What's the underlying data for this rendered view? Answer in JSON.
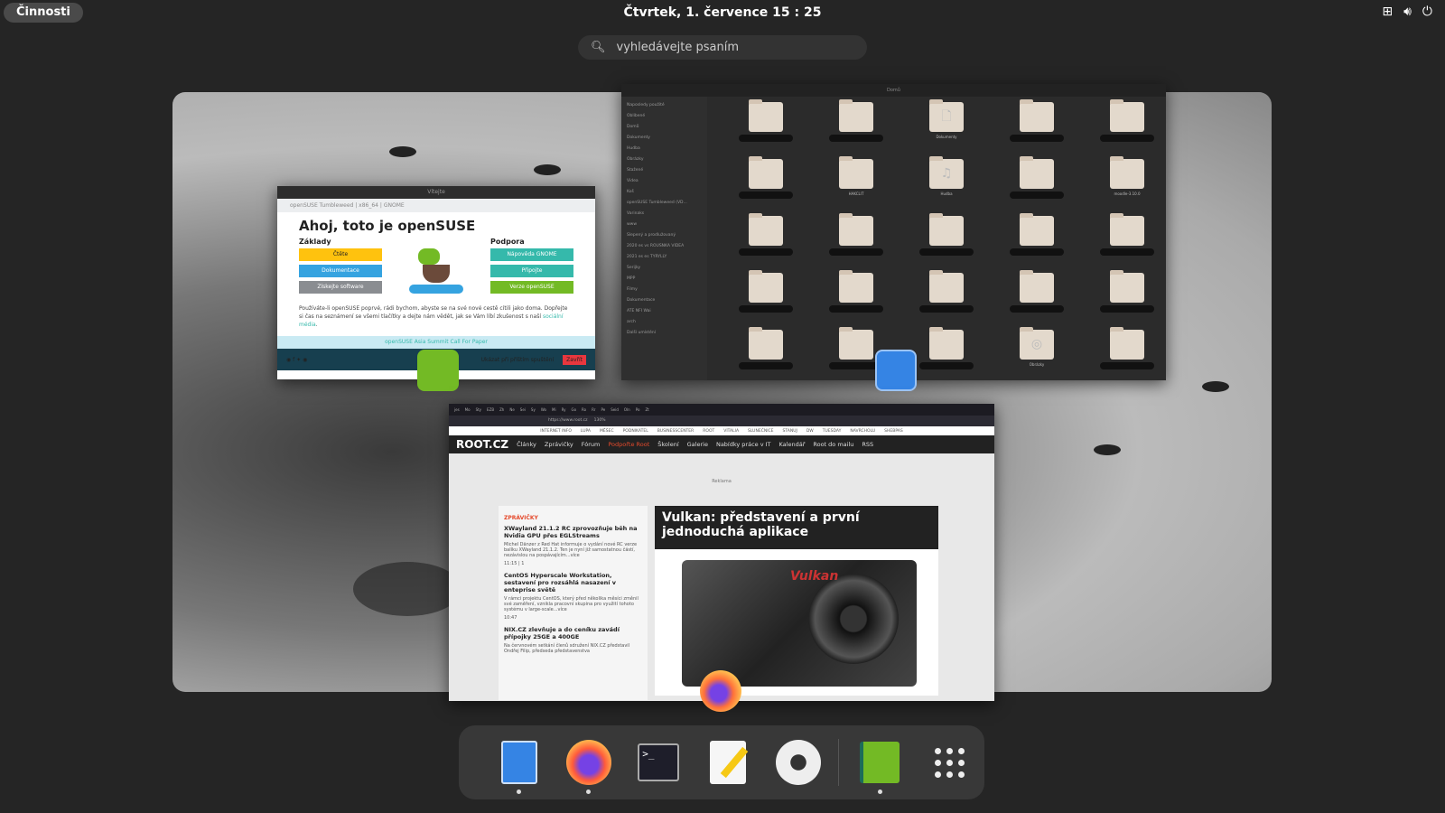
{
  "topbar": {
    "activities": "Činnosti",
    "clock": "Čtvrtek, 1. července  15 : 25",
    "tray_icons": [
      "network-icon",
      "volume-icon",
      "power-icon"
    ]
  },
  "search": {
    "placeholder": "vyhledávejte psaním"
  },
  "windows": {
    "welcome": {
      "title": "Vítejte",
      "crumb": "openSUSE Tumbleweed  |  x86_64  |  GNOME",
      "heading": "Ahoj, toto je openSUSE",
      "basics_title": "Základy",
      "basics": [
        {
          "label": "Čtěte",
          "color": "#ffc20e"
        },
        {
          "label": "Dokumentace",
          "color": "#35a3e0"
        },
        {
          "label": "Získejte software",
          "color": "#8a8d91"
        }
      ],
      "support_title": "Podpora",
      "support": [
        {
          "label": "Nápověda GNOME",
          "color": "#35b9ab"
        },
        {
          "label": "Připojte",
          "color": "#35b9ab"
        },
        {
          "label": "Verze openSUSE",
          "color": "#73ba25"
        }
      ],
      "text": "Používáte-li openSUSE poprvé, rádi bychom, abyste se na své nové cestě cítili jako doma. Dopřejte si čas na seznámení se všemi tlačítky a dejte nám vědět, jak se Vám líbí zkušenost s naší",
      "link": "sociální média",
      "banner": "openSUSE Asia Summit Call For Paper",
      "show_next": "Ukázat při příštím spuštění",
      "close": "Zavřít"
    },
    "files": {
      "title": "Domů",
      "sidebar": [
        "Naposledy použité",
        "Oblíbené",
        "Domů",
        "Dokumenty",
        "Hudba",
        "Obrázky",
        "Stažené",
        "Videa",
        "Koš",
        "openSUSE Tumbleweed (VD...",
        "Varinaks",
        "www",
        "Slepený a prodlužovaný",
        "2020 es vs ROUSNKA VIDEA",
        "2021 es es TYRYLLY",
        "Serijky",
        "MPP",
        "Filmy",
        "Dokumentace",
        "ATE NFI Wai",
        "arch",
        "Další umístění"
      ],
      "items": [
        "",
        "",
        "Dokumenty",
        "",
        "",
        "",
        "HAKCLIT",
        "Hudba",
        "",
        "moodle-3.10.0",
        "",
        "",
        "",
        "",
        "",
        "",
        "",
        "",
        "",
        "",
        "",
        "",
        "",
        "Obrázky",
        ""
      ]
    },
    "browser": {
      "tabs": [
        "jes",
        "Mo",
        "Sty",
        "EZB",
        "Zh",
        "Ne",
        "Sei",
        "Sy",
        "Wo",
        "Mi",
        "Ry",
        "Go",
        "Ro",
        "Rr",
        "Pe",
        "Seid",
        "Oln",
        "Po",
        "Zt"
      ],
      "url": "https://www.root.cz",
      "zoom": "130%",
      "network": [
        "INTERNET INFO",
        "LUPA",
        "MĚŠEC",
        "PODNIKATEL",
        "BUSINESSCENTER",
        "ROOT",
        "VITALIA",
        "SLUNEČNICE",
        "STANUJ",
        "DW",
        "TUESDAY",
        "NAVRCHOLU",
        "SHEBPAS"
      ],
      "logo": "ROOT.CZ",
      "nav": [
        "Články",
        "Zprávičky",
        "Fórum",
        "Podpořte Root",
        "Školení",
        "Galerie",
        "Nabídky práce v IT",
        "Kalendář",
        "Root do mailu",
        "RSS"
      ],
      "ad": "Reklama",
      "news_tag": "ZPRÁVIČKY",
      "news": [
        {
          "title": "XWayland 21.1.2 RC zprovozňuje běh na Nvidia GPU přes EGLStreams",
          "text": "Michel Dänzer z Red Hat informuje o vydání nové RC verze balíku XWayland 21.1.2. Ten je nyní již samostatnou částí, nezávislou na pospávajícím...více",
          "meta": "11:15 | 1"
        },
        {
          "title": "CentOS Hyperscale Workstation, sestavení pro rozsáhlá nasazení v enteprise světě",
          "text": "V rámci projektu CentOS, který před několika měsíci změnil své zaměření, vznikla pracovní skupina pro využití tohoto systému v large-scale...více",
          "meta": "10:47"
        },
        {
          "title": "NIX.CZ zlevňuje a do ceníku zavádí přípojky 25GE a 400GE",
          "text": "Na červnovém setkání členů sdružení NIX.CZ představil Ondřej Filip, předseda představenstva",
          "meta": ""
        }
      ],
      "feature_title": "Vulkan: představení a první jednoduchá aplikace",
      "feature_brand": "Vulkan"
    }
  },
  "dock": [
    {
      "name": "files",
      "running": true
    },
    {
      "name": "firefox",
      "running": true
    },
    {
      "name": "terminal",
      "running": false
    },
    {
      "name": "text-editor",
      "running": false
    },
    {
      "name": "settings",
      "running": false
    },
    {
      "name": "opensuse-welcome",
      "running": true
    },
    {
      "name": "show-apps",
      "running": false
    }
  ]
}
